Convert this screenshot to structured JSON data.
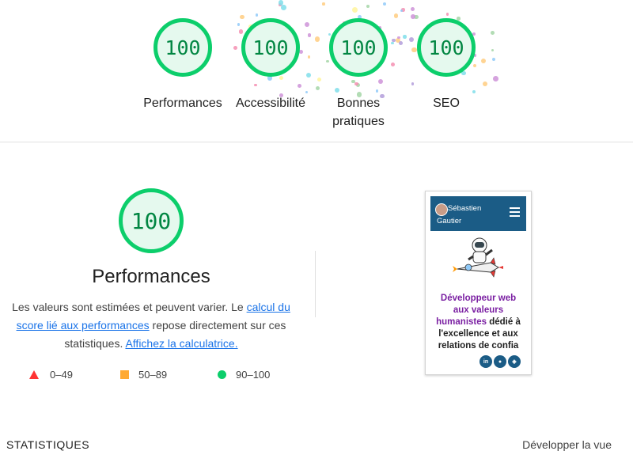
{
  "category_scores": [
    {
      "score": "100",
      "label": "Performances"
    },
    {
      "score": "100",
      "label": "Accessibilité"
    },
    {
      "score": "100",
      "label": "Bonnes pratiques"
    },
    {
      "score": "100",
      "label": "SEO"
    }
  ],
  "main": {
    "score": "100",
    "title": "Performances",
    "desc_before": "Les valeurs sont estimées et peuvent varier. Le ",
    "desc_link1": "calcul du score lié aux performances",
    "desc_middle": " repose directement sur ces statistiques. ",
    "desc_link2": "Affichez la calculatrice.",
    "legend": {
      "fail": "0–49",
      "average": "50–89",
      "pass": "90–100"
    }
  },
  "thumbnail": {
    "name": "Sébastien Gautier",
    "headline_purple": "Développeur web aux valeurs humanistes",
    "headline_rest": " dédié à l'excellence et aux relations de confia",
    "social_icons": [
      "linkedin-icon",
      "github-icon",
      "codepen-icon"
    ]
  },
  "footer": {
    "stats_label": "STATISTIQUES",
    "expand_label": "Développer la vue"
  },
  "colors": {
    "pass_green": "#0cce6b",
    "pass_text": "#018642",
    "fail_red": "#ff3333",
    "average_orange": "#ffaa33",
    "link_blue": "#1a73e8",
    "thumb_header": "#1b5c86",
    "thumb_purple": "#7a1fa2"
  }
}
